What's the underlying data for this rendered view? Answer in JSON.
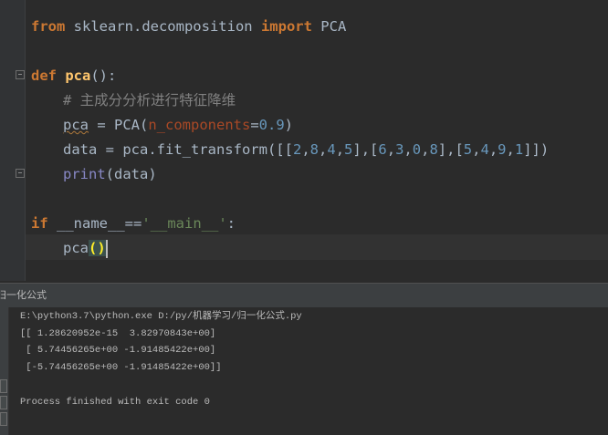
{
  "editor": {
    "line1": {
      "kw_from": "from",
      "module": " sklearn.decomposition ",
      "kw_import": "import",
      "name": " PCA"
    },
    "line2": {
      "kw_def": "def",
      "fname": "pca",
      "rest": "():"
    },
    "line3": {
      "comment": "# 主成分分析进行特征降维"
    },
    "line4": {
      "var": "pca",
      "eq": " = PCA(",
      "param": "n_components",
      "op": "=",
      "num": "0.9",
      "close": ")"
    },
    "line5": {
      "prefix": "data = pca.fit_transform([[",
      "row1": [
        "2",
        "8",
        "4",
        "5"
      ],
      "row2": [
        "6",
        "3",
        "0",
        "8"
      ],
      "row3": [
        "5",
        "4",
        "9",
        "1"
      ],
      "suffix": "]])"
    },
    "line6": {
      "builtin": "print",
      "rest": "(data)"
    },
    "line7": {
      "kw_if": "if",
      "rest": " __name__==",
      "str": "'__main__'",
      "colon": ":"
    },
    "line8": {
      "call": "pca",
      "parens": "()"
    }
  },
  "run_panel": {
    "title": "归一化公式",
    "output": [
      "E:\\python3.7\\python.exe D:/py/机器学习/归一化公式.py",
      "[[ 1.28620952e-15  3.82970843e+00]",
      " [ 5.74456265e+00 -1.91485422e+00]",
      " [-5.74456265e+00 -1.91485422e+00]]",
      "",
      "Process finished with exit code 0"
    ]
  },
  "colors": {
    "background": "#2b2b2b",
    "keyword": "#cc7832",
    "function": "#ffc66d",
    "comment": "#808080",
    "number": "#6897bb",
    "string": "#6a8759",
    "parameter": "#aa4926",
    "builtin": "#8888c6"
  }
}
